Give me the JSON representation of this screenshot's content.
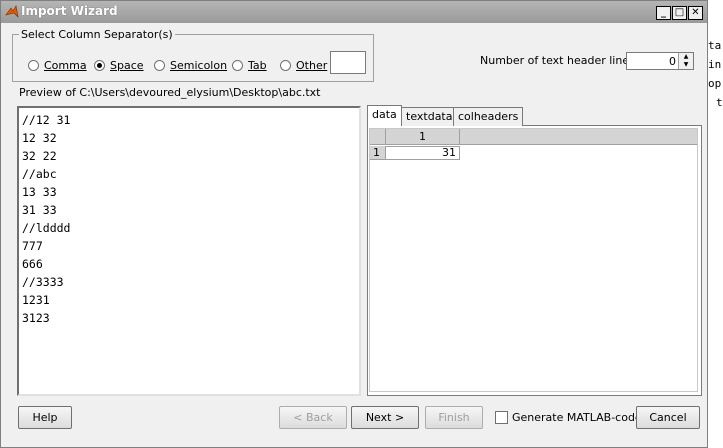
{
  "window": {
    "title": "Import Wizard",
    "min_label": "_",
    "max_label": "□",
    "close_label": "✕"
  },
  "separator": {
    "legend": "Select Column Separator(s)",
    "options": [
      {
        "label": "Comma",
        "selected": false
      },
      {
        "label": "Space",
        "selected": true
      },
      {
        "label": "Semicolon",
        "selected": false
      },
      {
        "label": "Tab",
        "selected": false
      },
      {
        "label": "Other",
        "selected": false
      }
    ],
    "other_value": ""
  },
  "header_lines": {
    "label": "Number of text header lines:",
    "value": "0"
  },
  "preview": {
    "label": "Preview of C:\\Users\\devoured_elysium\\Desktop\\abc.txt",
    "lines": [
      "//12 31",
      "12 32",
      "32 22",
      "//abc",
      "13 33",
      "31 33",
      "//ldddd",
      "777",
      "666",
      "//3333",
      "1231",
      "3123"
    ]
  },
  "tabs": [
    {
      "label": "data",
      "active": true
    },
    {
      "label": "textdata",
      "active": false
    },
    {
      "label": "colheaders",
      "active": false
    }
  ],
  "grid": {
    "col_header": "1",
    "row_header": "1",
    "cell_value": "31"
  },
  "buttons": {
    "help": "Help",
    "back": "< Back",
    "next": "Next >",
    "finish": "Finish",
    "generate_code": "Generate MATLAB-code",
    "cancel": "Cancel"
  },
  "background_text": [
    "ta",
    "in",
    "op",
    "",
    "t"
  ],
  "colors": {
    "titlebar": "#a8a8a8",
    "dialog_bg": "#f0f0f0",
    "disabled_text": "#a0a0a0"
  }
}
